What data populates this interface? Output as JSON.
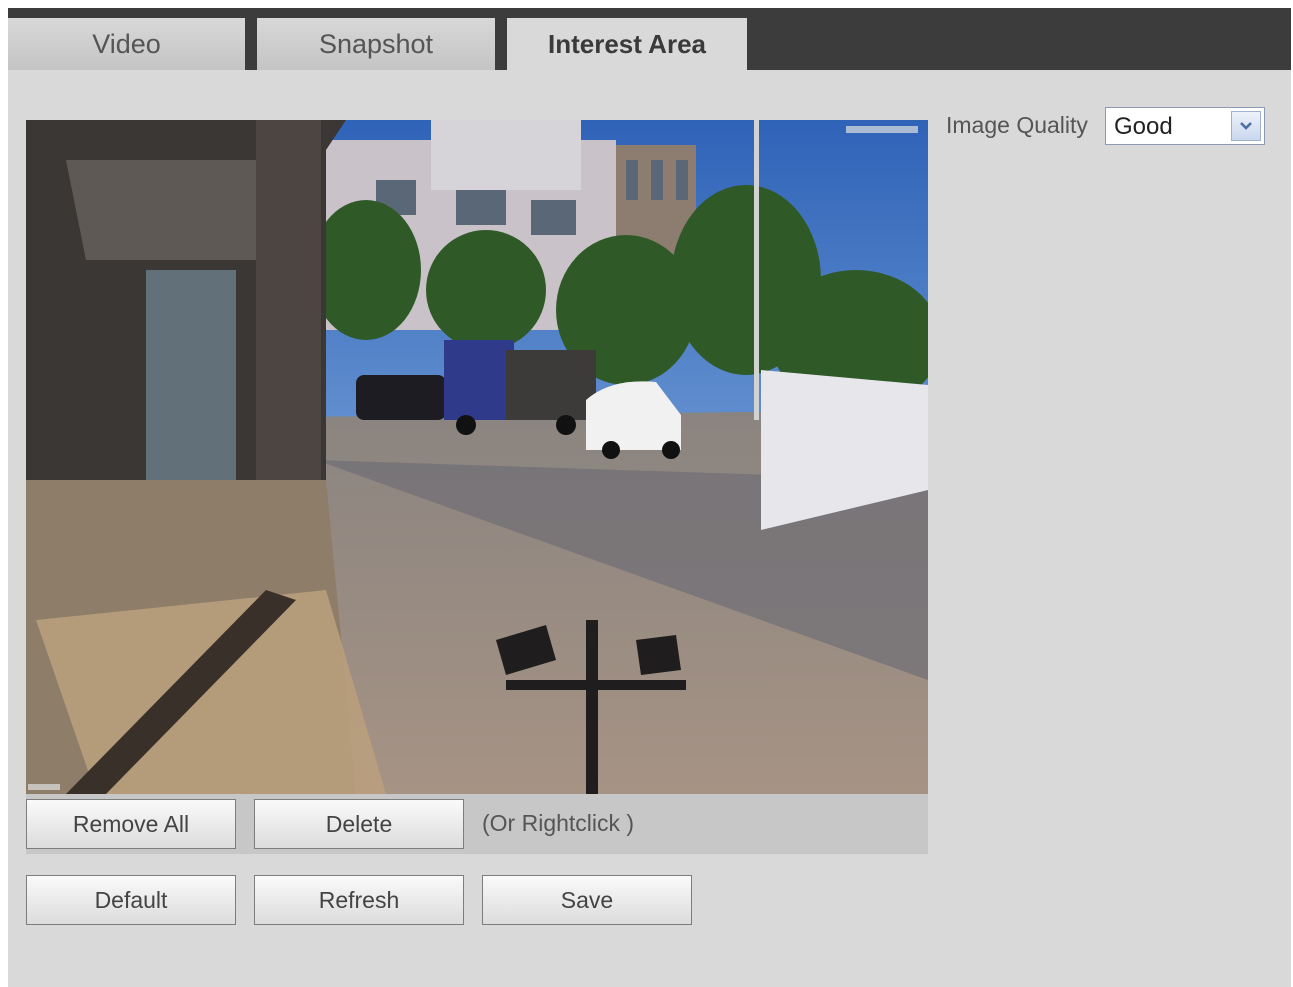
{
  "tabs": [
    {
      "label": "Video",
      "active": false
    },
    {
      "label": "Snapshot",
      "active": false
    },
    {
      "label": "Interest Area",
      "active": true
    }
  ],
  "image_quality": {
    "label": "Image Quality",
    "value": "Good"
  },
  "region_actions": {
    "remove_all": "Remove All",
    "delete": "Delete",
    "hint": "(Or Rightclick )"
  },
  "footer_buttons": {
    "default": "Default",
    "refresh": "Refresh",
    "save": "Save"
  },
  "colors": {
    "tab_bar": "#3c3c3c",
    "panel_bg": "#d9d9d9",
    "action_bar": "#c7c7c7"
  },
  "icons": {
    "dropdown": "chevron-down-icon"
  }
}
